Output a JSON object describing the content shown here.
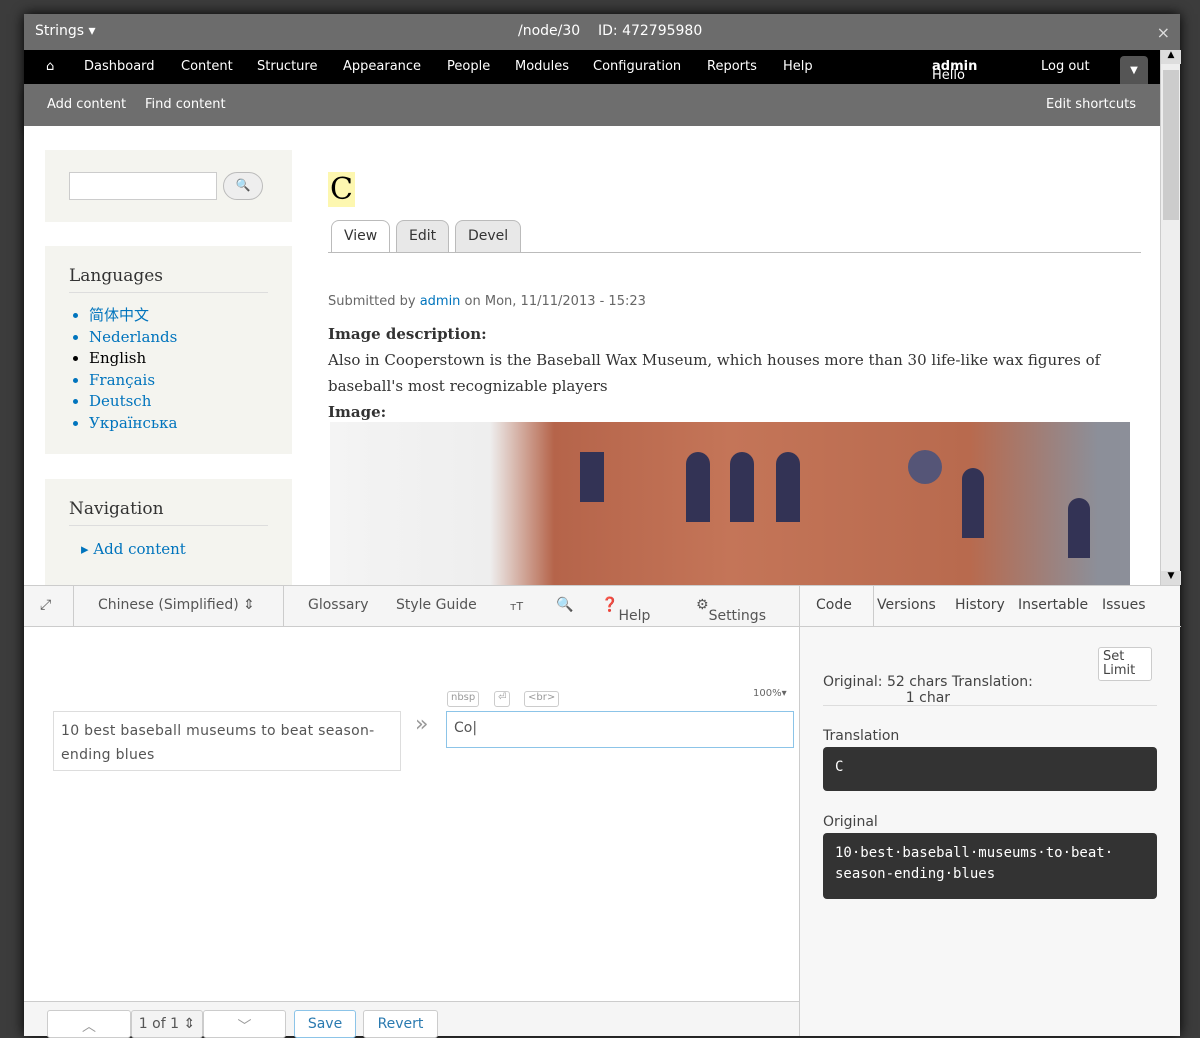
{
  "titlebar": {
    "menu": "Strings ▾",
    "path": "/node/30",
    "id": "ID: 472795980",
    "close": "×"
  },
  "toolbar": {
    "home": "⌂",
    "items": [
      "Dashboard",
      "Content",
      "Structure",
      "Appearance",
      "People",
      "Modules",
      "Configuration",
      "Reports",
      "Help"
    ],
    "hello": "Hello ",
    "user": "admin",
    "logout": "Log out"
  },
  "shortcuts": {
    "add": "Add content",
    "find": "Find content",
    "edit": "Edit shortcuts"
  },
  "sidebar": {
    "search_button": "🔍",
    "languages_title": "Languages",
    "languages": [
      "简体中文",
      "Nederlands",
      "English",
      "Français",
      "Deutsch",
      "Українська"
    ],
    "navigation_title": "Navigation",
    "nav_items": [
      "Add content"
    ]
  },
  "node": {
    "title": "C",
    "tabs": [
      "View",
      "Edit",
      "Devel"
    ],
    "submitted_prefix": "Submitted by ",
    "author": "admin",
    "submitted_suffix": " on Mon, 11/11/2013 - 15:23",
    "image_desc_label": "Image description:",
    "image_desc": "Also in Cooperstown is the Baseball Wax Museum, which houses more than 30 life-like wax figures of baseball's most recognizable players",
    "image_label": "Image:"
  },
  "editor": {
    "language": "Chinese (Simplified) ⇕",
    "tools": [
      "Glossary",
      "Style Guide",
      "Help",
      "Settings"
    ],
    "original": "10 best baseball museums to beat season-ending blues",
    "translation": "Co",
    "zoom": "100%▾",
    "mini": [
      "nbsp",
      "⏎",
      "<br>"
    ],
    "pager": "1 of 1 ⇕",
    "save": "Save",
    "revert": "Revert"
  },
  "right_panel": {
    "tabs": [
      "Code",
      "Versions",
      "History",
      "Insertable",
      "Issues"
    ],
    "counts": "Original: 52 chars Translation:",
    "counts2": "1 char",
    "set_limit": "Set Limit",
    "translation_label": "Translation",
    "translation_code": "C",
    "original_label": "Original",
    "original_code": "10·best·baseball·museums·to·beat· season-ending·blues"
  }
}
